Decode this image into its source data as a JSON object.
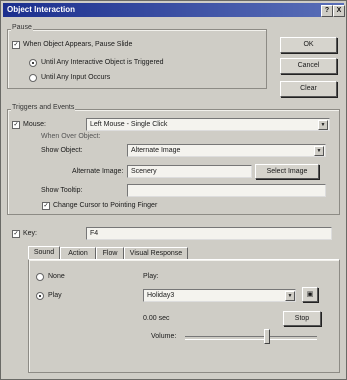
{
  "window": {
    "title": "Object Interaction",
    "help_glyph": "?",
    "close_glyph": "X"
  },
  "buttons": {
    "ok": "OK",
    "cancel": "Cancel",
    "clear": "Clear"
  },
  "pause": {
    "group_label": "Pause",
    "when_appears": "When Object Appears, Pause Slide",
    "until_triggered": "Until Any Interactive Object is Triggered",
    "until_input": "Until Any Input Occurs"
  },
  "triggers": {
    "group_label": "Triggers and Events",
    "mouse_label": "Mouse:",
    "mouse_value": "Left Mouse - Single Click",
    "when_over_label": "When Over Object:",
    "show_object_label": "Show Object:",
    "show_object_value": "Alternate Image",
    "alternate_image_label": "Alternate Image:",
    "alternate_image_value": "Scenery",
    "select_image_label": "Select Image",
    "show_tooltip_label": "Show Tooltip:",
    "show_tooltip_value": "",
    "change_cursor_label": "Change Cursor to Pointing Finger"
  },
  "key": {
    "label": "Key:",
    "value": "F4"
  },
  "tabs": [
    "Sound",
    "Action",
    "Flow",
    "Visual Response"
  ],
  "sound": {
    "none_label": "None",
    "play_label": "Play",
    "play_header": "Play:",
    "play_value": "Holiday3",
    "duration": "0.00 sec",
    "stop_label": "Stop",
    "volume_label": "Volume:",
    "volume_level": 0.62
  },
  "icons": {
    "dropdown": "chevron-down-icon",
    "browse": "folder-icon"
  }
}
